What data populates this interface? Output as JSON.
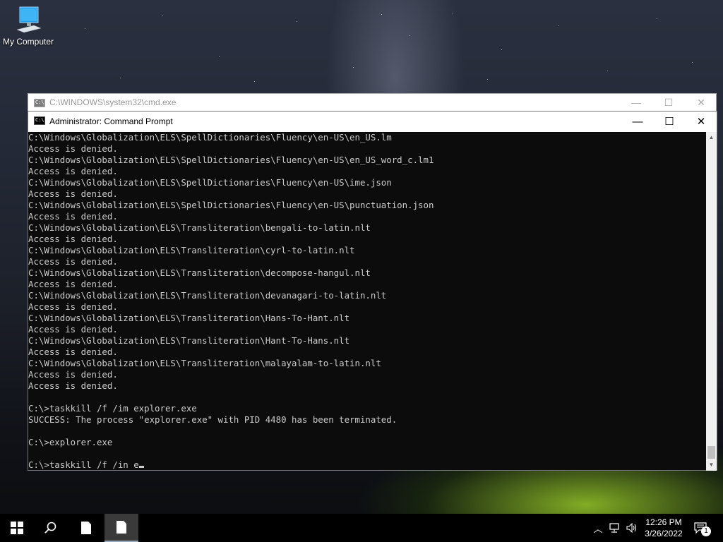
{
  "desktop": {
    "icons": [
      {
        "label": "My Computer",
        "icon": "computer-icon"
      }
    ]
  },
  "window_back": {
    "title": "C:\\WINDOWS\\system32\\cmd.exe",
    "app_icon_text": "C:\\."
  },
  "window_front": {
    "title": "Administrator: Command Prompt",
    "app_icon_text": "C:\\."
  },
  "console": {
    "lines": [
      "C:\\Windows\\Globalization\\ELS\\SpellDictionaries\\Fluency\\en-US\\en_US.lm",
      "Access is denied.",
      "C:\\Windows\\Globalization\\ELS\\SpellDictionaries\\Fluency\\en-US\\en_US_word_c.lm1",
      "Access is denied.",
      "C:\\Windows\\Globalization\\ELS\\SpellDictionaries\\Fluency\\en-US\\ime.json",
      "Access is denied.",
      "C:\\Windows\\Globalization\\ELS\\SpellDictionaries\\Fluency\\en-US\\punctuation.json",
      "Access is denied.",
      "C:\\Windows\\Globalization\\ELS\\Transliteration\\bengali-to-latin.nlt",
      "Access is denied.",
      "C:\\Windows\\Globalization\\ELS\\Transliteration\\cyrl-to-latin.nlt",
      "Access is denied.",
      "C:\\Windows\\Globalization\\ELS\\Transliteration\\decompose-hangul.nlt",
      "Access is denied.",
      "C:\\Windows\\Globalization\\ELS\\Transliteration\\devanagari-to-latin.nlt",
      "Access is denied.",
      "C:\\Windows\\Globalization\\ELS\\Transliteration\\Hans-To-Hant.nlt",
      "Access is denied.",
      "C:\\Windows\\Globalization\\ELS\\Transliteration\\Hant-To-Hans.nlt",
      "Access is denied.",
      "C:\\Windows\\Globalization\\ELS\\Transliteration\\malayalam-to-latin.nlt",
      "Access is denied.",
      "Access is denied.",
      "",
      "C:\\>taskkill /f /im explorer.exe",
      "SUCCESS: The process \"explorer.exe\" with PID 4480 has been terminated.",
      "",
      "C:\\>explorer.exe",
      "",
      "C:\\>taskkill /f /in e"
    ]
  },
  "taskbar": {
    "start_icon": "windows-logo-icon",
    "search_icon": "search-icon",
    "apps": [
      "blank-document-icon",
      "blank-document-icon"
    ],
    "clock_time": "12:26 PM",
    "clock_date": "3/26/2022",
    "notification_count": "1"
  },
  "colors": {
    "console_bg": "#0c0c0c",
    "console_fg": "#cccccc",
    "taskbar_bg": "#000000"
  }
}
